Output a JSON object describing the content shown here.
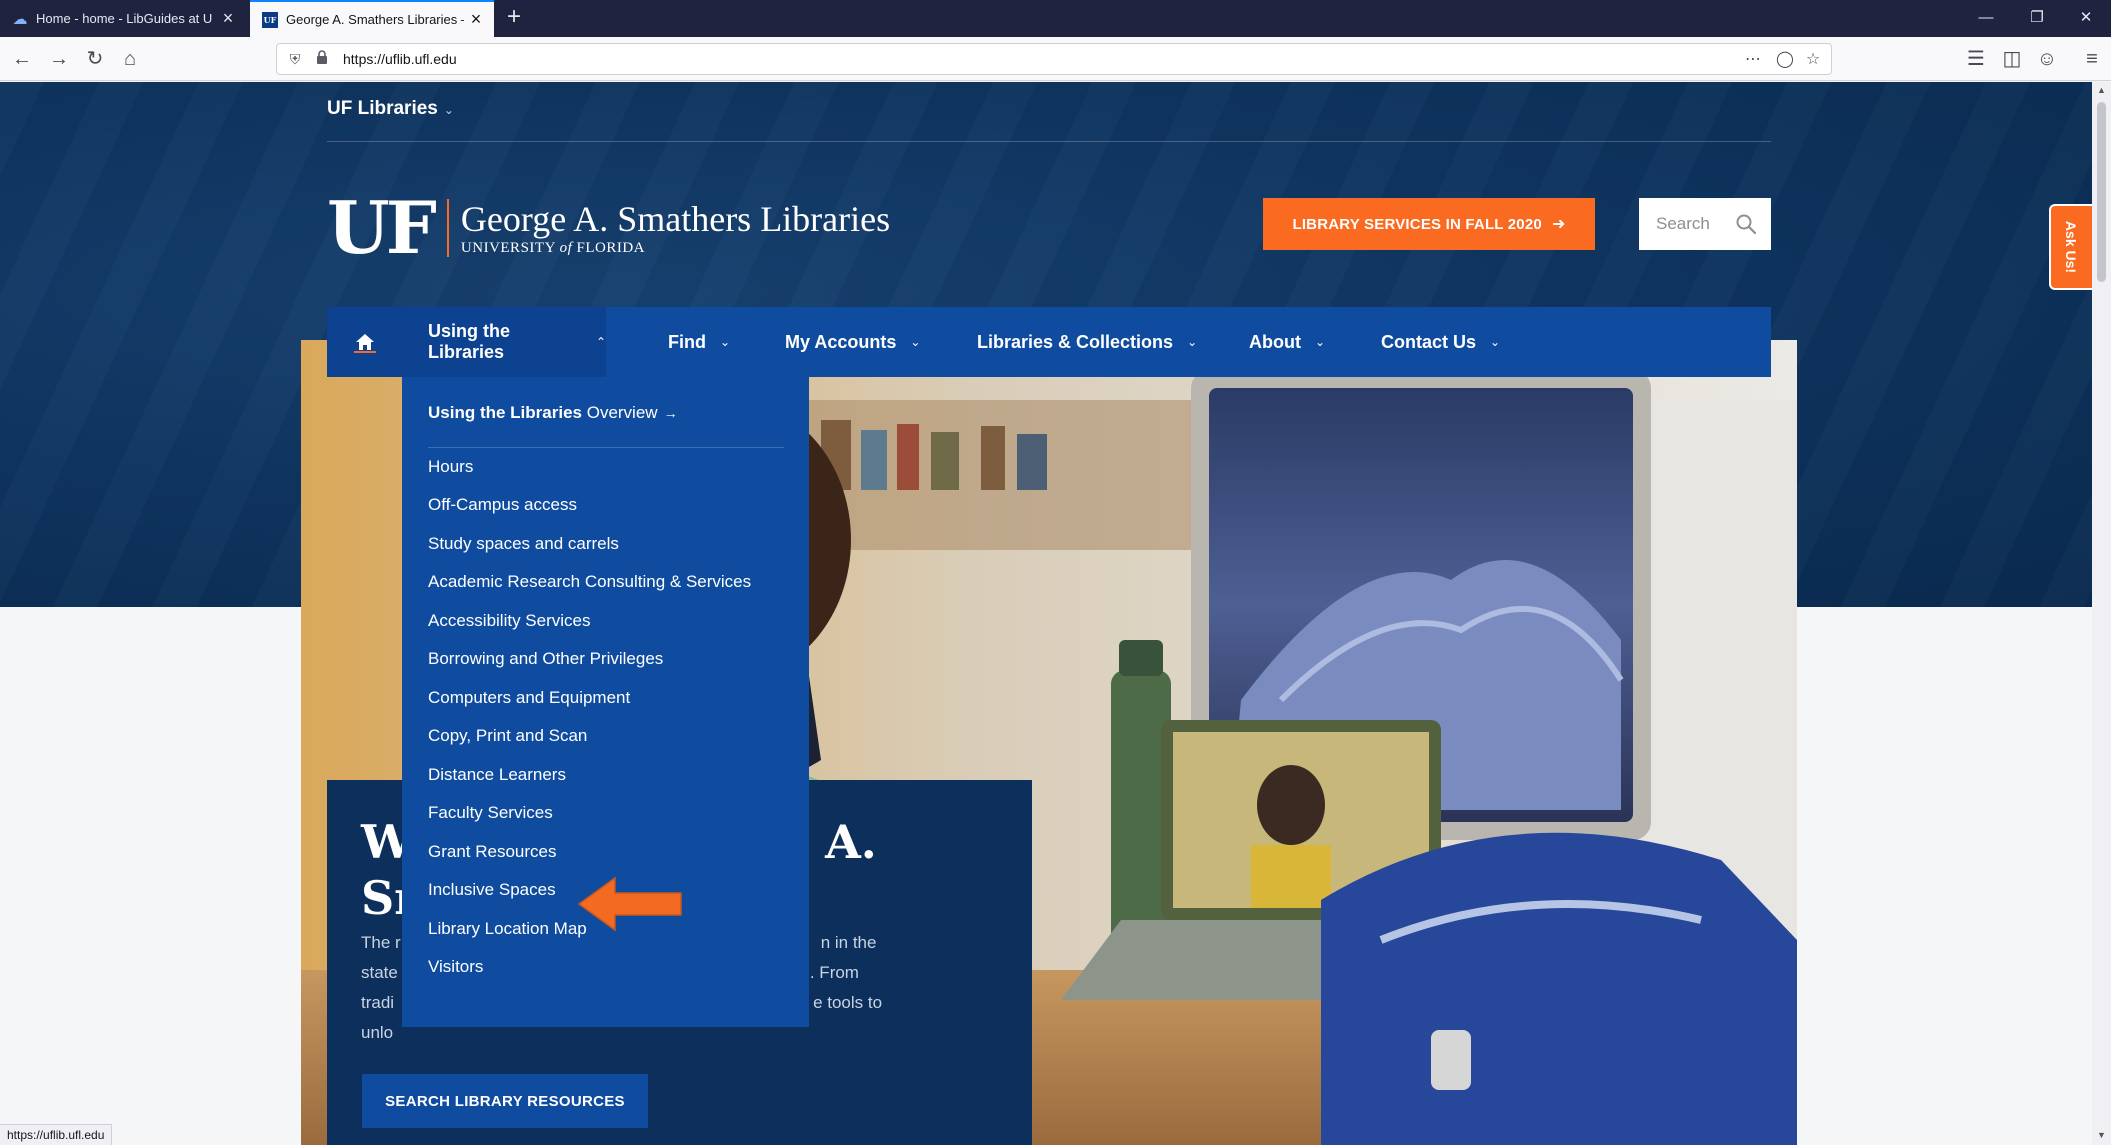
{
  "browser": {
    "tabs": [
      {
        "title": "Home - home - LibGuides at U",
        "active": false
      },
      {
        "title": "George A. Smathers Libraries –",
        "active": true
      }
    ],
    "new_tab": "+",
    "url": "https://uflib.ufl.edu",
    "status_url": "https://uflib.ufl.edu"
  },
  "header": {
    "network": "UF Libraries",
    "logo_mark": "UF",
    "logo_name": "George A. Smathers Libraries",
    "logo_sub_pre": "UNIVERSITY",
    "logo_sub_of": "of",
    "logo_sub_post": "FLORIDA",
    "cta": "LIBRARY SERVICES IN FALL 2020",
    "search_placeholder": "Search",
    "ask_us": "Ask Us!"
  },
  "nav": {
    "items": [
      {
        "label": "Using the Libraries",
        "open": true
      },
      {
        "label": "Find"
      },
      {
        "label": "My Accounts"
      },
      {
        "label": "Libraries & Collections"
      },
      {
        "label": "About"
      },
      {
        "label": "Contact Us"
      }
    ]
  },
  "dropdown": {
    "overview_bold": "Using the Libraries",
    "overview_rest": "Overview",
    "items": [
      "Hours",
      "Off-Campus access",
      "Study spaces and carrels",
      "Academic Research Consulting & Services",
      "Accessibility Services",
      "Borrowing and Other Privileges",
      "Computers and Equipment",
      "Copy, Print and Scan",
      "Distance Learners",
      "Faculty Services",
      "Grant Resources",
      "Inclusive Spaces",
      "Library Location Map",
      "Visitors"
    ],
    "highlighted": "Faculty Services"
  },
  "hero": {
    "title_left": "W",
    "title_left2": "Sr",
    "title_right": "ge A.",
    "body_left": [
      "The r",
      "state",
      "tradi",
      "unlo"
    ],
    "body_right": [
      "n in the",
      ". From",
      "e tools to"
    ],
    "button": "SEARCH LIBRARY RESOURCES"
  },
  "colors": {
    "brand_blue": "#0f4c9f",
    "navy": "#0c2f5c",
    "orange": "#fa6a20"
  }
}
